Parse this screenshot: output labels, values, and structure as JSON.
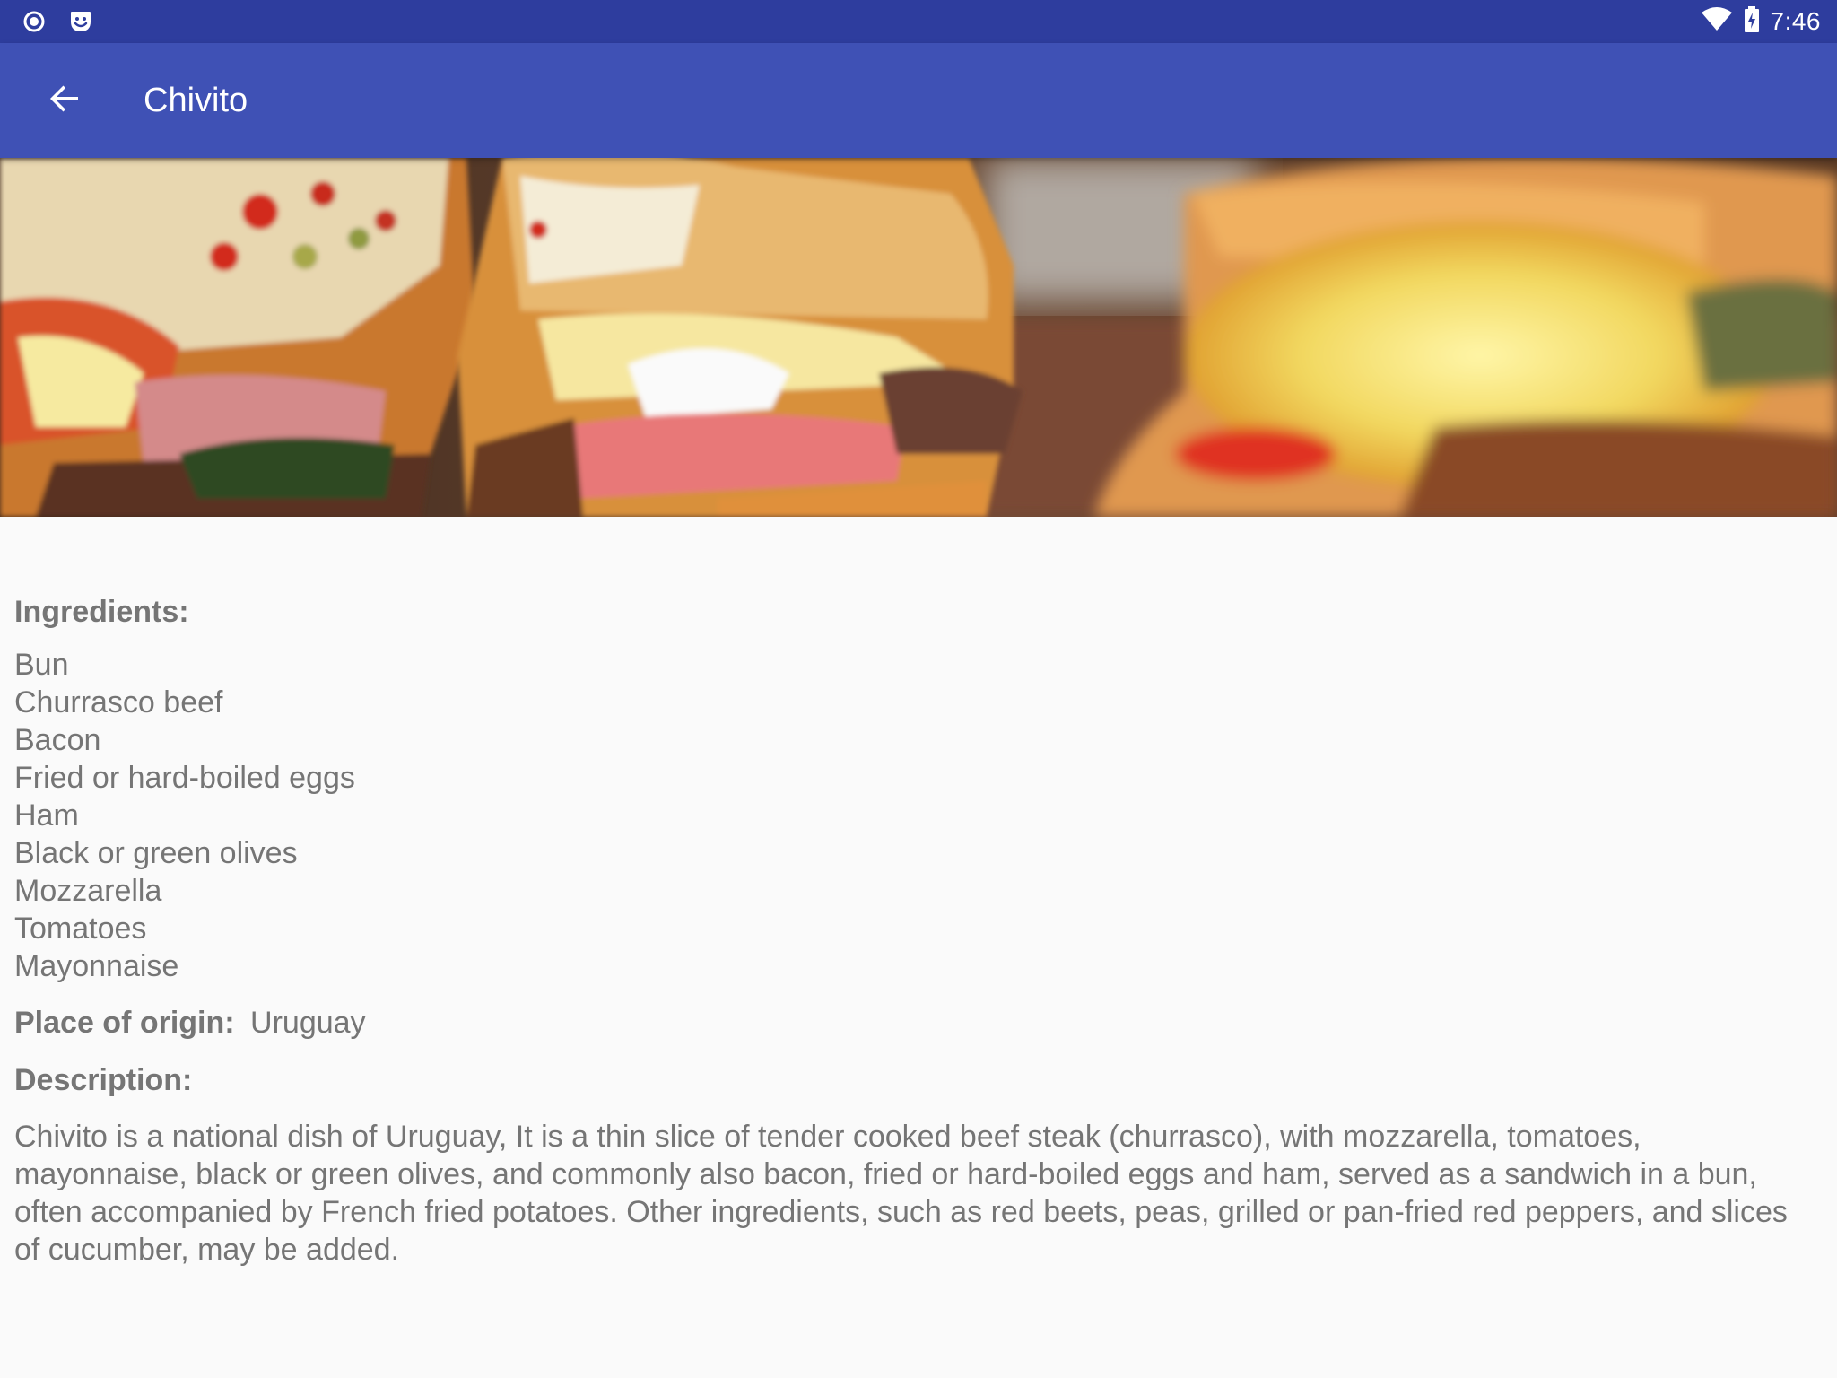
{
  "status_bar": {
    "time": "7:46",
    "left_icons": [
      "record-icon",
      "notification-face-icon"
    ],
    "right_icons": [
      "wifi-icon",
      "battery-charging-icon"
    ]
  },
  "app_bar": {
    "title": "Chivito",
    "nav_icon": "back-arrow-icon",
    "background_color": "#3f51b5",
    "status_bar_color": "#2e3d9e"
  },
  "hero_image": {
    "subject": "Chivito sandwich photo"
  },
  "details": {
    "ingredients_label": "Ingredients:",
    "ingredients": [
      "Bun",
      "Churrasco beef",
      "Bacon",
      "Fried or hard-boiled eggs",
      "Ham",
      "Black or green olives",
      "Mozzarella",
      "Tomatoes",
      "Mayonnaise"
    ],
    "origin_label": "Place of origin:",
    "origin_value": "Uruguay",
    "description_label": "Description:",
    "description": "Chivito is a national dish of Uruguay, It is a thin slice of tender cooked beef steak (churrasco), with mozzarella, tomatoes, mayonnaise, black or green olives, and commonly also bacon, fried or hard-boiled eggs and ham, served as a sandwich in a bun, often accompanied by French fried potatoes. Other ingredients, such as red beets, peas, grilled or pan-fried red peppers, and slices of cucumber, may be added."
  }
}
